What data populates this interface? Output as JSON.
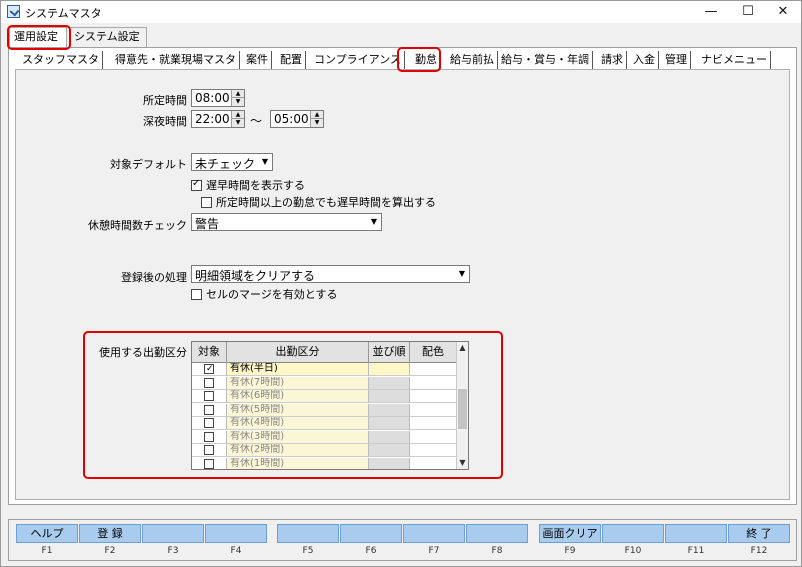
{
  "window": {
    "title": "システムマスタ",
    "min_glyph": "—",
    "max_glyph": "☐",
    "close_glyph": "✕"
  },
  "top_tabs": [
    "運用設定",
    "システム設定"
  ],
  "sub_tabs": [
    "スタッフマスタ",
    "得意先・就業現場マスタ",
    "案件",
    "配置",
    "コンプライアンス",
    "勤怠",
    "給与前払",
    "給与・賞与・年調",
    "請求",
    "入金",
    "管理",
    "ナビメニュー"
  ],
  "form": {
    "scheduled_time_label": "所定時間",
    "scheduled_time_value": "08:00",
    "night_time_label": "深夜時間",
    "night_start": "22:00",
    "range_sep": "～",
    "night_end": "05:00",
    "target_default_label": "対象デフォルト",
    "target_default_value": "未チェック",
    "show_late_early_label": "遅早時間を表示する",
    "show_late_early_checked": true,
    "calc_late_early_label": "所定時間以上の勤怠でも遅早時間を算出する",
    "calc_late_early_checked": false,
    "break_check_label": "休憩時間数チェック",
    "break_check_value": "警告",
    "after_register_label": "登録後の処理",
    "after_register_value": "明細領域をクリアする",
    "cell_merge_label": "セルのマージを有効とする",
    "cell_merge_checked": false,
    "attendance_types_label": "使用する出勤区分"
  },
  "grid": {
    "headers": [
      "対象",
      "出勤区分",
      "並び順",
      "配色"
    ],
    "rows": [
      {
        "checked": true,
        "name": "有休(半日)"
      },
      {
        "checked": false,
        "name": "有休(7時間)"
      },
      {
        "checked": false,
        "name": "有休(6時間)"
      },
      {
        "checked": false,
        "name": "有休(5時間)"
      },
      {
        "checked": false,
        "name": "有休(4時間)"
      },
      {
        "checked": false,
        "name": "有休(3時間)"
      },
      {
        "checked": false,
        "name": "有休(2時間)"
      },
      {
        "checked": false,
        "name": "有休(1時間)"
      }
    ]
  },
  "fkeys": [
    {
      "label": "ヘルプ",
      "key": "F1"
    },
    {
      "label": "登 録",
      "key": "F2"
    },
    {
      "label": "",
      "key": "F3"
    },
    {
      "label": "",
      "key": "F4"
    },
    {
      "label": "",
      "key": "F5"
    },
    {
      "label": "",
      "key": "F6"
    },
    {
      "label": "",
      "key": "F7"
    },
    {
      "label": "",
      "key": "F8"
    },
    {
      "label": "画面クリア",
      "key": "F9"
    },
    {
      "label": "",
      "key": "F10"
    },
    {
      "label": "",
      "key": "F11"
    },
    {
      "label": "終 了",
      "key": "F12"
    }
  ],
  "colors": {
    "fkey_button": "#a9cbee",
    "highlight": "#e00000",
    "grid_row_highlight": "#fff7c8"
  }
}
